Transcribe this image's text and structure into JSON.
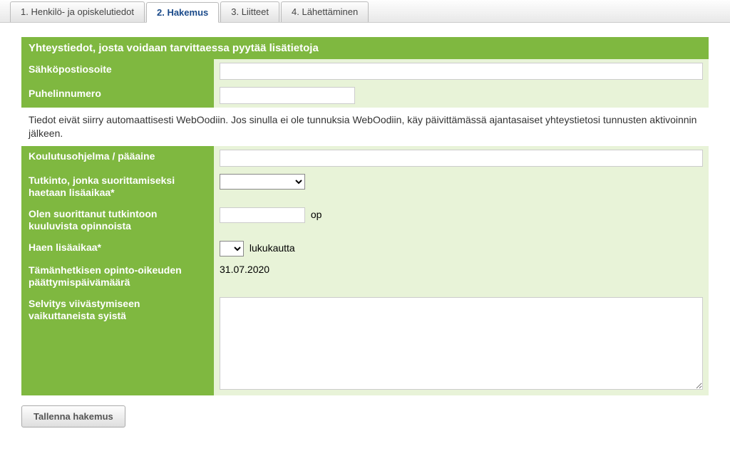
{
  "tabs": {
    "t1": "1. Henkilö- ja opiskelutiedot",
    "t2": "2. Hakemus",
    "t3": "3. Liitteet",
    "t4": "4. Lähettäminen"
  },
  "section": {
    "header": "Yhteystiedot, josta voidaan tarvittaessa pyytää lisätietoja",
    "email_label": "Sähköpostiosoite",
    "phone_label": "Puhelinnumero",
    "info": "Tiedot eivät siirry automaattisesti WebOodiin. Jos sinulla ei ole tunnuksia WebOodiin, käy päivittämässä ajantasaiset yhteystietosi tunnusten aktivoinnin jälkeen.",
    "program_label": "Koulutusohjelma / pääaine",
    "degree_label": "Tutkinto, jonka suorittamiseksi haetaan lisäaikaa*",
    "credits_label": "Olen suorittanut tutkintoon kuuluvista opinnoista",
    "credits_unit": "op",
    "duration_label": "Haen lisäaikaa*",
    "duration_unit": "lukukautta",
    "enddate_label": "Tämänhetkisen opinto-oikeuden päättymispäivämäärä",
    "enddate_value": "31.07.2020",
    "reason_label": "Selvitys viivästymiseen vaikuttaneista syistä"
  },
  "buttons": {
    "save": "Tallenna hakemus"
  },
  "values": {
    "email": "",
    "phone": "",
    "program": "",
    "degree": "",
    "credits": "",
    "duration": "",
    "reason": ""
  }
}
